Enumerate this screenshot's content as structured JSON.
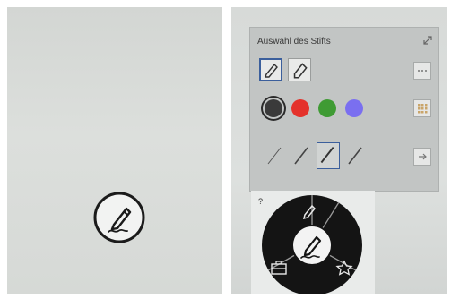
{
  "left_photo": {
    "pen_button_icon": "pen-with-scribble-icon"
  },
  "right_photo": {
    "pen_panel": {
      "title": "Auswahl des Stifts",
      "expand_icon": "expand-diagonal-icon",
      "pen_types": [
        {
          "icon": "pen-icon",
          "selected": true
        },
        {
          "icon": "highlighter-icon",
          "selected": false
        }
      ],
      "colors": [
        {
          "hex": "#3a3a3a",
          "selected": true
        },
        {
          "hex": "#e4322b",
          "selected": false
        },
        {
          "hex": "#3f9b34",
          "selected": false
        },
        {
          "hex": "#7a6ff0",
          "selected": false
        }
      ],
      "thicknesses": [
        {
          "level": 1,
          "selected": false
        },
        {
          "level": 2,
          "selected": false
        },
        {
          "level": 3,
          "selected": true
        },
        {
          "level": 2,
          "selected": false
        }
      ],
      "side_icons": [
        "more-icon",
        "grid-icon",
        "collapse-icon"
      ]
    },
    "radial_menu": {
      "help_label": "?",
      "segments": [
        "pen-icon",
        "star-icon",
        "toolbox-icon"
      ],
      "center_icon": "pen-with-scribble-icon"
    }
  }
}
